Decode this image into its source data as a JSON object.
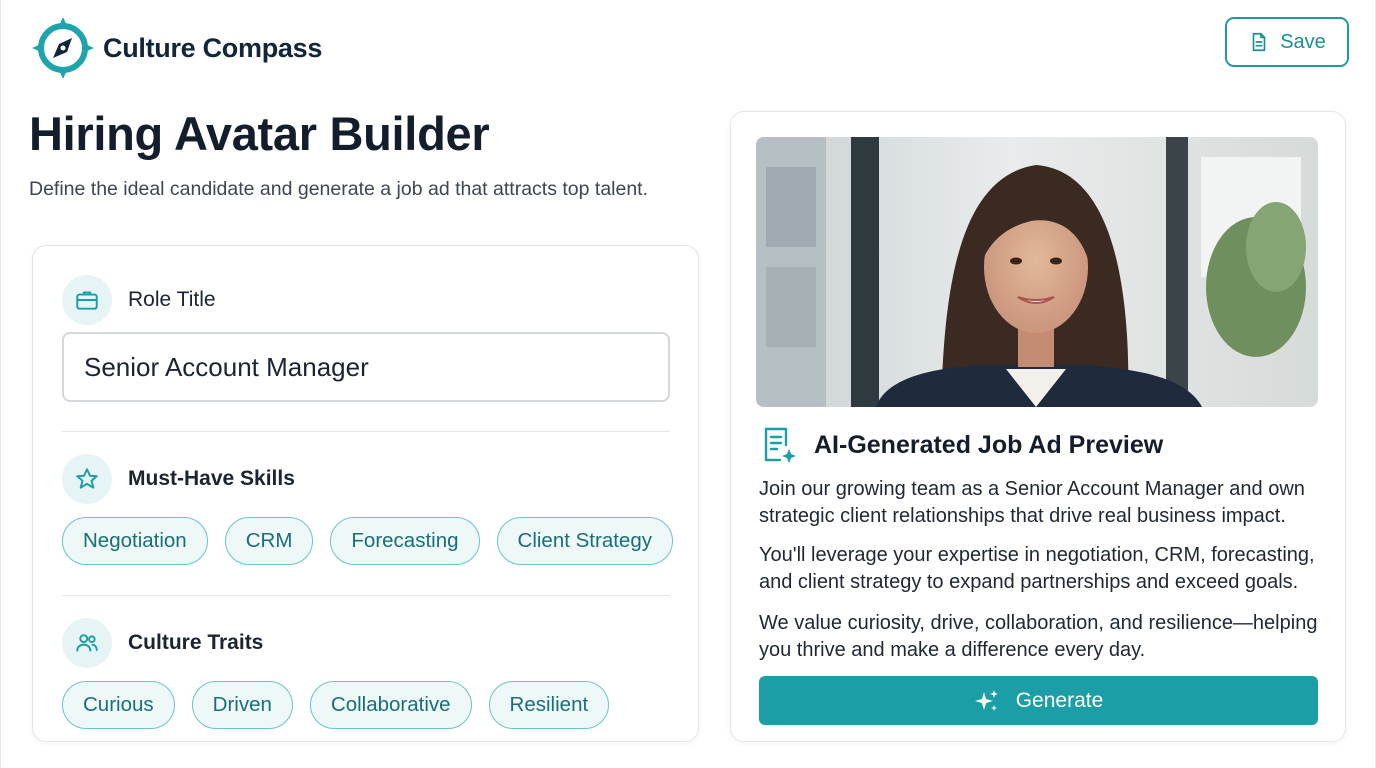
{
  "app": {
    "name": "Culture Compass"
  },
  "toolbar": {
    "save_label": "Save"
  },
  "page": {
    "title": "Hiring Avatar Builder",
    "subtitle": "Define the ideal candidate and generate a job ad that attracts top talent."
  },
  "form": {
    "role": {
      "label": "Role Title",
      "value": "Senior Account Manager"
    },
    "skills": {
      "label": "Must-Have Skills",
      "chips": [
        "Negotiation",
        "CRM",
        "Forecasting",
        "Client Strategy"
      ]
    },
    "traits": {
      "label": "Culture Traits",
      "chips": [
        "Curious",
        "Driven",
        "Collaborative",
        "Resilient"
      ]
    }
  },
  "preview": {
    "title": "AI-Generated Job Ad Preview",
    "paragraphs": [
      "Join our growing team as a Senior Account Manager and own strategic client relationships that drive real business impact.",
      "You'll leverage your expertise in negotiation, CRM, forecasting, and client strategy to expand partnerships and exceed goals.",
      "We value curiosity, drive, collaboration, and resilience—helping you thrive and make a difference every day."
    ],
    "generate_label": "Generate"
  },
  "icons": {
    "logo": "compass-icon",
    "save": "document-icon",
    "role": "briefcase-icon",
    "skills": "star-icon",
    "traits": "users-icon",
    "preview": "document-sparkle-icon",
    "generate": "sparkles-icon"
  },
  "colors": {
    "accent": "#1c9ea6",
    "brand_dark": "#12253a",
    "chip_bg": "#eef8f8",
    "chip_border": "#6ec3c6"
  }
}
